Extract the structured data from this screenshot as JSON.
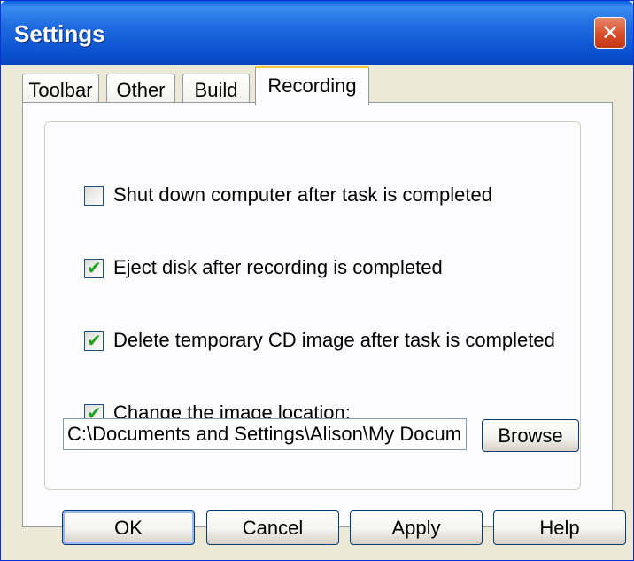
{
  "window": {
    "title": "Settings",
    "close_glyph": "✕"
  },
  "tabs": [
    {
      "label": "Toolbar",
      "active": false
    },
    {
      "label": "Other",
      "active": false
    },
    {
      "label": "Build",
      "active": false
    },
    {
      "label": "Recording",
      "active": true
    }
  ],
  "recording": {
    "options": [
      {
        "label": "Shut down computer after task is completed",
        "checked": false
      },
      {
        "label": "Eject disk after recording is completed",
        "checked": true
      },
      {
        "label": "Delete temporary CD image after task is completed",
        "checked": true
      },
      {
        "label": "Change the image location:",
        "checked": true
      }
    ],
    "checkmark_glyph": "✔",
    "image_location_value": "C:\\Documents and Settings\\Alison\\My Documents",
    "browse_label": "Browse"
  },
  "buttons": {
    "ok": "OK",
    "cancel": "Cancel",
    "apply": "Apply",
    "help": "Help"
  },
  "colors": {
    "titlebar": "#0b52d0",
    "active_tab_accent": "#ffc83c",
    "checkmark": "#21a121",
    "close_button": "#d64a25"
  }
}
